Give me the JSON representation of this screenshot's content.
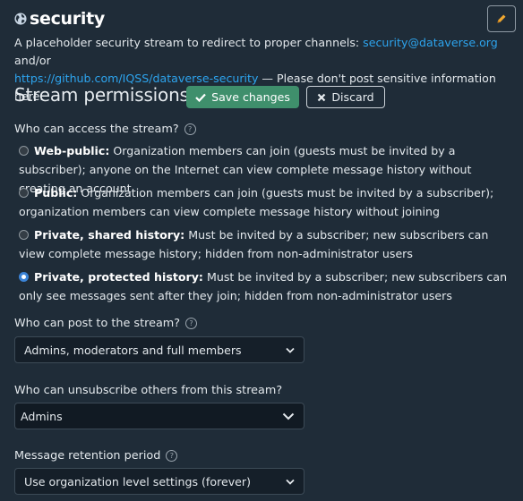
{
  "stream": {
    "name": "security",
    "description_prefix": "A placeholder security stream to redirect to proper channels: ",
    "email_link": "security@dataverse.org",
    "description_mid": " and/or",
    "url_link": "https://github.com/IQSS/dataverse-security",
    "description_suffix": " — Please don't post sensitive information here."
  },
  "permissions": {
    "heading": "Stream permissions",
    "save_label": "Save changes",
    "discard_label": "Discard",
    "access_question": "Who can access the stream?",
    "options": [
      {
        "title": "Web-public:",
        "text": " Organization members can join (guests must be invited by a subscriber); anyone on the Internet can view complete message history without creating an account",
        "checked": false
      },
      {
        "title": "Public:",
        "text": " Organization members can join (guests must be invited by a subscriber); organization members can view complete message history without joining",
        "checked": false
      },
      {
        "title": "Private, shared history:",
        "text": " Must be invited by a subscriber; new subscribers can view complete message history; hidden from non-administrator users",
        "checked": false
      },
      {
        "title": "Private, protected history:",
        "text": " Must be invited by a subscriber; new subscribers can only see messages sent after they join; hidden from non-administrator users",
        "checked": true
      }
    ],
    "post_question": "Who can post to the stream?",
    "post_value": "Admins, moderators and full members",
    "unsubscribe_question": "Who can unsubscribe others from this stream?",
    "unsubscribe_value": "Admins",
    "retention_question": "Message retention period",
    "retention_value": "Use organization level settings (forever)"
  },
  "colors": {
    "background": "#1f2c38",
    "accent_green": "#3f8f6c",
    "link": "#2da4ee",
    "edit_icon": "#f0a830"
  },
  "icons": {
    "globe": "globe-icon",
    "edit": "pencil-icon",
    "save": "check-icon",
    "discard": "x-icon",
    "help": "question-circle-icon",
    "dropdown": "chevron-down-icon"
  }
}
